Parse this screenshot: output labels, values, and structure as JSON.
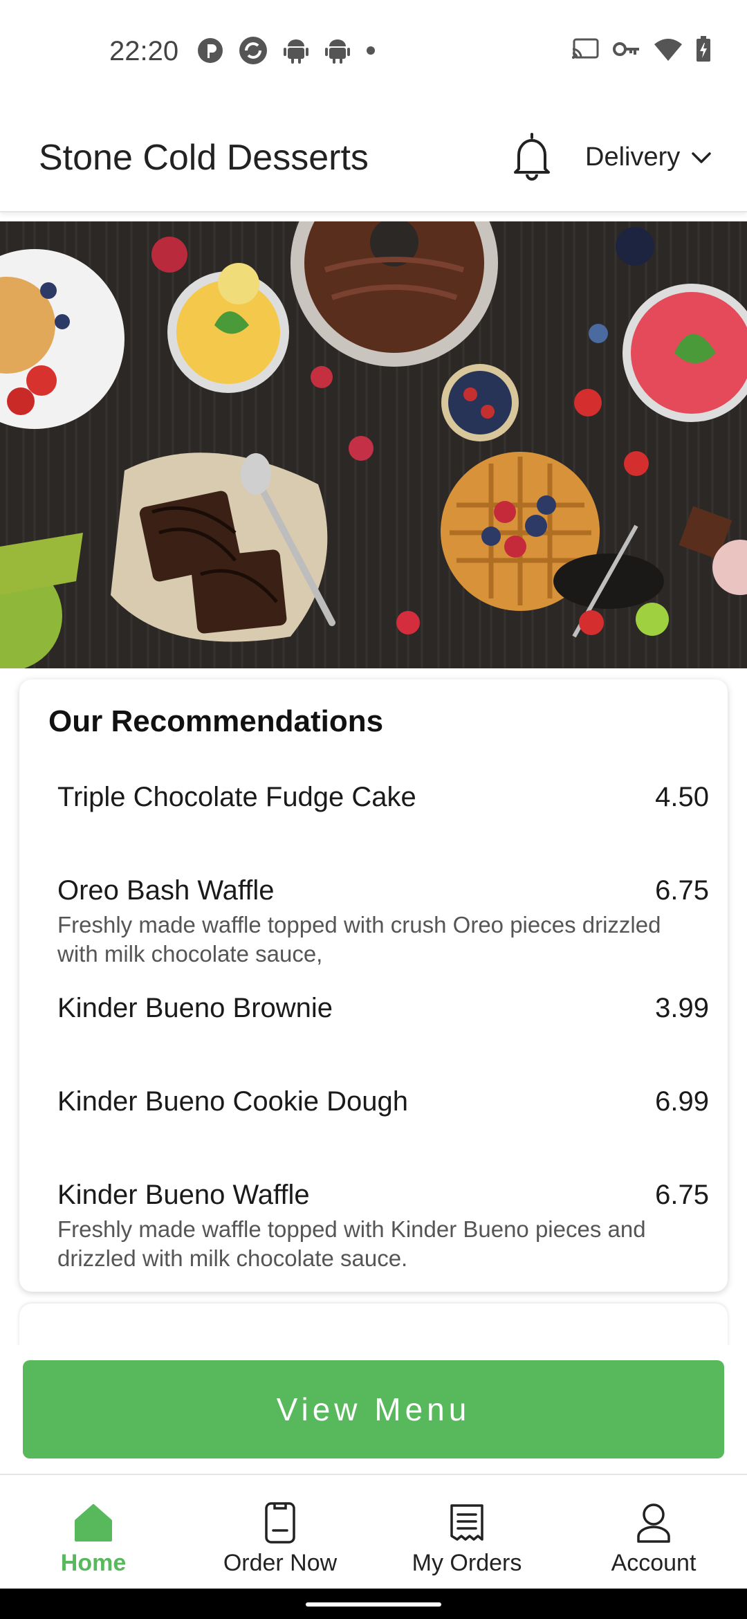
{
  "status_bar": {
    "time": "22:20",
    "left_icons": [
      "pinterest-icon",
      "sync-icon",
      "android-icon",
      "android-icon",
      "dot-icon"
    ],
    "right_icons": [
      "cast-icon",
      "vpn-key-icon",
      "wifi-icon",
      "battery-icon"
    ]
  },
  "header": {
    "title": "Stone Cold Desserts",
    "bell_icon": "bell-icon",
    "delivery_label": "Delivery",
    "dropdown_icon": "chevron-down-icon"
  },
  "hero": {
    "image": "desserts-banner-image"
  },
  "recommendations": {
    "title": "Our Recommendations",
    "items": [
      {
        "name": "Triple Chocolate Fudge Cake",
        "price": "4.50",
        "description": ""
      },
      {
        "name": "Oreo Bash Waffle",
        "price": "6.75",
        "description": "Freshly made waffle topped with crush Oreo pieces drizzled with milk chocolate sauce,"
      },
      {
        "name": "Kinder Bueno Brownie",
        "price": "3.99",
        "description": ""
      },
      {
        "name": "Kinder Bueno Cookie Dough",
        "price": "6.99",
        "description": ""
      },
      {
        "name": "Kinder Bueno Waffle",
        "price": "6.75",
        "description": "Freshly made waffle topped with Kinder Bueno pieces and drizzled with milk chocolate sauce."
      }
    ]
  },
  "view_menu_label": "View Menu",
  "bottom_nav": [
    {
      "label": "Home",
      "icon": "home-icon",
      "active": true
    },
    {
      "label": "Order Now",
      "icon": "receipt-icon",
      "active": false
    },
    {
      "label": "My Orders",
      "icon": "list-receipt-icon",
      "active": false
    },
    {
      "label": "Account",
      "icon": "user-icon",
      "active": false
    }
  ],
  "colors": {
    "accent": "#58b85c",
    "text": "#1a1a1a",
    "muted": "#555555",
    "hero_bg": "#2a2726"
  }
}
